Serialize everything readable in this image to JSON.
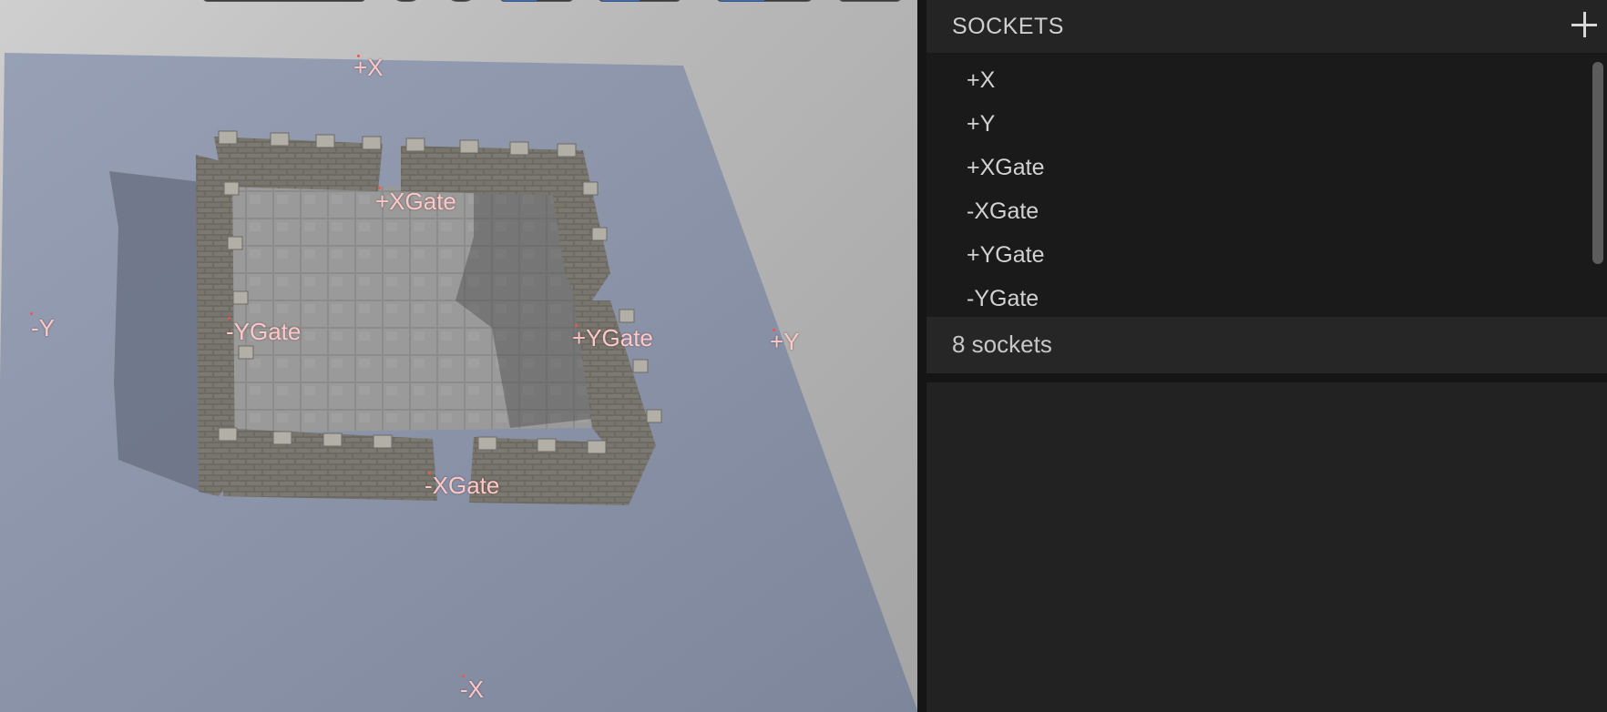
{
  "panel": {
    "title": "SOCKETS",
    "add_icon": "plus-icon",
    "sockets": [
      "+X",
      "+Y",
      "+XGate",
      "-XGate",
      "+YGate",
      "-YGate"
    ],
    "count_text": "8 sockets"
  },
  "viewport": {
    "labels": {
      "plus_x": "+X",
      "minus_x": "-X",
      "plus_y": "+Y",
      "minus_y": "-Y",
      "plus_xgate": "+XGate",
      "minus_xgate": "-XGate",
      "plus_ygate": "+YGate",
      "minus_ygate": "-YGate"
    },
    "label_color": "#ffc8c8",
    "ground_color": "#8891a6"
  }
}
